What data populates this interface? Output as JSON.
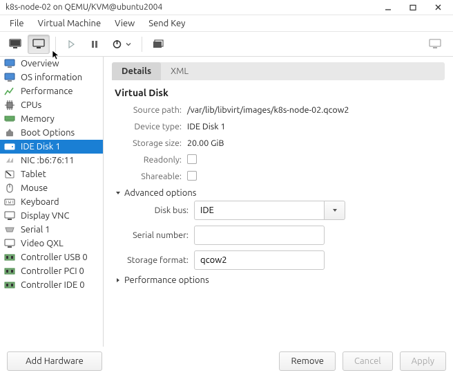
{
  "window": {
    "title": "k8s-node-02 on QEMU/KVM@ubuntu2004"
  },
  "menubar": {
    "file": "File",
    "virtual_machine": "Virtual Machine",
    "view": "View",
    "send_key": "Send Key"
  },
  "sidebar": {
    "items": [
      {
        "label": "Overview"
      },
      {
        "label": "OS information"
      },
      {
        "label": "Performance"
      },
      {
        "label": "CPUs"
      },
      {
        "label": "Memory"
      },
      {
        "label": "Boot Options"
      },
      {
        "label": "IDE Disk 1"
      },
      {
        "label": "NIC :b6:76:11"
      },
      {
        "label": "Tablet"
      },
      {
        "label": "Mouse"
      },
      {
        "label": "Keyboard"
      },
      {
        "label": "Display VNC"
      },
      {
        "label": "Serial 1"
      },
      {
        "label": "Video QXL"
      },
      {
        "label": "Controller USB 0"
      },
      {
        "label": "Controller PCI 0"
      },
      {
        "label": "Controller IDE 0"
      }
    ],
    "selected_index": 6,
    "add_hardware": "Add Hardware"
  },
  "tabs": {
    "details": "Details",
    "xml": "XML"
  },
  "details": {
    "heading": "Virtual Disk",
    "source_path_label": "Source path:",
    "source_path": "/var/lib/libvirt/images/k8s-node-02.qcow2",
    "device_type_label": "Device type:",
    "device_type": "IDE Disk 1",
    "storage_size_label": "Storage size:",
    "storage_size": "20.00 GiB",
    "readonly_label": "Readonly:",
    "readonly": false,
    "shareable_label": "Shareable:",
    "shareable": false,
    "advanced_label": "Advanced options",
    "disk_bus_label": "Disk bus:",
    "disk_bus": "IDE",
    "serial_label": "Serial number:",
    "serial": "",
    "storage_format_label": "Storage format:",
    "storage_format": "qcow2",
    "performance_label": "Performance options"
  },
  "footer": {
    "remove": "Remove",
    "cancel": "Cancel",
    "apply": "Apply"
  }
}
